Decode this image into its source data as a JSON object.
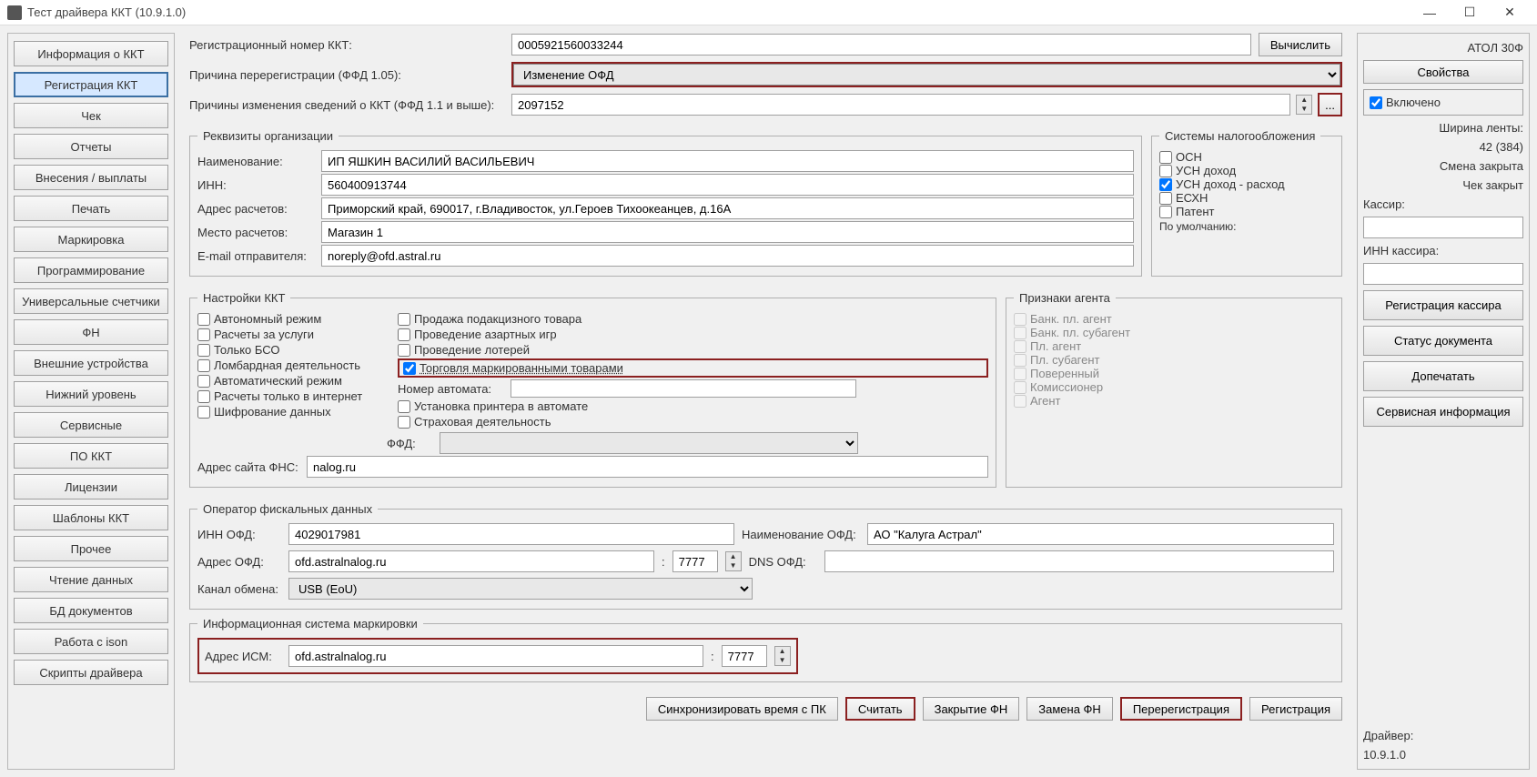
{
  "window": {
    "title": "Тест драйвера ККТ (10.9.1.0)"
  },
  "nav": [
    "Информация о ККТ",
    "Регистрация ККТ",
    "Чек",
    "Отчеты",
    "Внесения / выплаты",
    "Печать",
    "Маркировка",
    "Программирование",
    "Универсальные счетчики",
    "ФН",
    "Внешние устройства",
    "Нижний уровень",
    "Сервисные",
    "ПО ККТ",
    "Лицензии",
    "Шаблоны ККТ",
    "Прочее",
    "Чтение данных",
    "БД документов",
    "Работа с ison",
    "Скрипты драйвера"
  ],
  "nav_selected": 1,
  "reg": {
    "num_lbl": "Регистрационный номер ККТ:",
    "num_val": "0005921560033244",
    "btn_calc": "Вычислить",
    "reason_lbl": "Причина перерегистрации (ФФД 1.05):",
    "reason_val": "Изменение ОФД",
    "reasons11_lbl": "Причины изменения сведений о ККТ (ФФД 1.1 и выше):",
    "reasons11_val": "2097152",
    "more_btn": "..."
  },
  "org": {
    "legend": "Реквизиты организации",
    "name_lbl": "Наименование:",
    "name_val": "ИП ЯШКИН ВАСИЛИЙ ВАСИЛЬЕВИЧ",
    "inn_lbl": "ИНН:",
    "inn_val": "560400913744",
    "addr_lbl": "Адрес расчетов:",
    "addr_val": "Приморский край, 690017, г.Владивосток, ул.Героев Тихоокеанцев, д.16А",
    "place_lbl": "Место расчетов:",
    "place_val": "Магазин 1",
    "email_lbl": "E-mail отправителя:",
    "email_val": "noreply@ofd.astral.ru"
  },
  "tax": {
    "legend": "Системы налогообложения",
    "options": [
      "ОСН",
      "УСН доход",
      "УСН доход - расход",
      "ЕСХН",
      "Патент"
    ],
    "checked": [
      false,
      false,
      true,
      false,
      false
    ],
    "default_lbl": "По умолчанию:"
  },
  "kkt": {
    "legend": "Настройки ККТ",
    "col1": [
      "Автономный режим",
      "Расчеты за услуги",
      "Только БСО",
      "Ломбардная деятельность",
      "Автоматический режим",
      "Расчеты только в интернет",
      "Шифрование данных"
    ],
    "col2": [
      "Продажа подакцизного товара",
      "Проведение азартных игр",
      "Проведение лотерей",
      "Торговля маркированными товарами",
      "Номер автомата:",
      "Установка принтера в автомате",
      "Страховая деятельность"
    ],
    "col2_highlight_index": 3,
    "ffd_lbl": "ФФД:",
    "fns_lbl": "Адрес сайта ФНС:",
    "fns_val": "nalog.ru"
  },
  "agent": {
    "legend": "Признаки агента",
    "options": [
      "Банк. пл. агент",
      "Банк. пл. субагент",
      "Пл. агент",
      "Пл. субагент",
      "Поверенный",
      "Комиссионер",
      "Агент"
    ]
  },
  "ofd": {
    "legend": "Оператор фискальных данных",
    "inn_lbl": "ИНН ОФД:",
    "inn_val": "4029017981",
    "name_lbl": "Наименование ОФД:",
    "name_val": "АО \"Калуга Астрал\"",
    "addr_lbl": "Адрес ОФД:",
    "addr_val": "ofd.astralnalog.ru",
    "port_val": "7777",
    "dns_lbl": "DNS ОФД:",
    "channel_lbl": "Канал обмена:",
    "channel_val": "USB (EoU)"
  },
  "ism": {
    "legend": "Информационная система маркировки",
    "addr_lbl": "Адрес ИСМ:",
    "addr_val": "ofd.astralnalog.ru",
    "port_val": "7777"
  },
  "footer": [
    "Синхронизировать время с ПК",
    "Считать",
    "Закрытие ФН",
    "Замена ФН",
    "Перерегистрация",
    "Регистрация"
  ],
  "right": {
    "device": "АТОЛ 30Ф",
    "btn_props": "Свойства",
    "enabled_lbl": "Включено",
    "tape_lbl": "Ширина ленты:",
    "tape_val": "42 (384)",
    "shift_lbl": "Смена закрыта",
    "receipt_lbl": "Чек закрыт",
    "cashier_lbl": "Кассир:",
    "cashier_inn_lbl": "ИНН кассира:",
    "btns": [
      "Регистрация кассира",
      "Статус документа",
      "Допечатать",
      "Сервисная информация"
    ],
    "driver_lbl": "Драйвер:",
    "driver_val": "10.9.1.0"
  },
  "colon": ":"
}
